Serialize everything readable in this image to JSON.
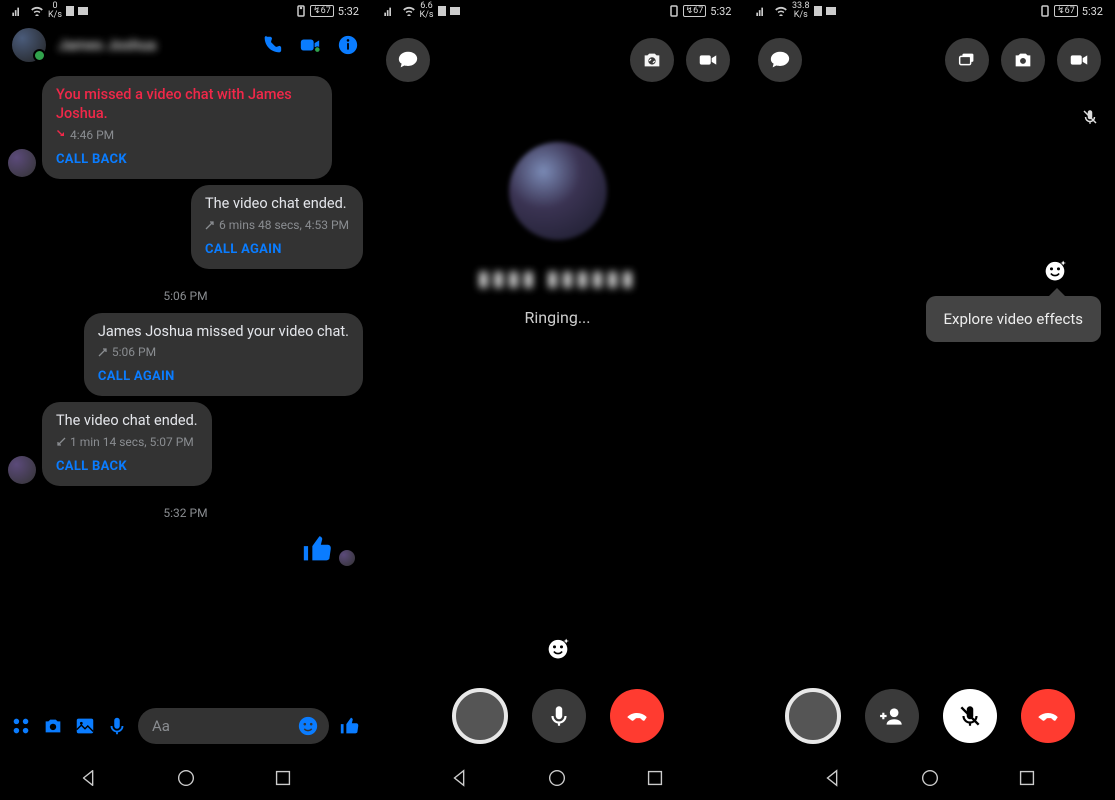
{
  "colors": {
    "accent_blue": "#0a7cff",
    "accent_red": "#f02849",
    "hangup": "#ff3b30"
  },
  "status": {
    "net1": "0",
    "net1u": "K/s",
    "net2": "6.6",
    "net2u": "K/s",
    "net3": "33.8",
    "net3u": "K/s",
    "battery": "67",
    "time": "5:32"
  },
  "chat": {
    "header": {
      "name": "James Joshua"
    },
    "messages": [
      {
        "side": "left",
        "avatar": true,
        "main": "You missed a video chat with James Joshua.",
        "main_style": "red",
        "meta_icon": "missed",
        "meta": "4:46 PM",
        "action": "CALL BACK"
      },
      {
        "side": "right",
        "main": "The video chat ended.",
        "meta_icon": "out",
        "meta": "6 mins 48 secs, 4:53 PM",
        "action": "CALL AGAIN"
      },
      {
        "timestamp": "5:06 PM"
      },
      {
        "side": "right",
        "main": "James Joshua missed your video chat.",
        "meta_icon": "out",
        "meta": "5:06 PM",
        "action": "CALL AGAIN"
      },
      {
        "side": "left",
        "avatar": true,
        "main": "The video chat ended.",
        "meta_icon": "in",
        "meta": "1 min 14 secs, 5:07 PM",
        "action": "CALL BACK"
      },
      {
        "timestamp": "5:32 PM"
      }
    ],
    "composer": {
      "placeholder": "Aa"
    }
  },
  "call2": {
    "status": "Ringing..."
  },
  "call3": {
    "tooltip": "Explore video effects"
  }
}
